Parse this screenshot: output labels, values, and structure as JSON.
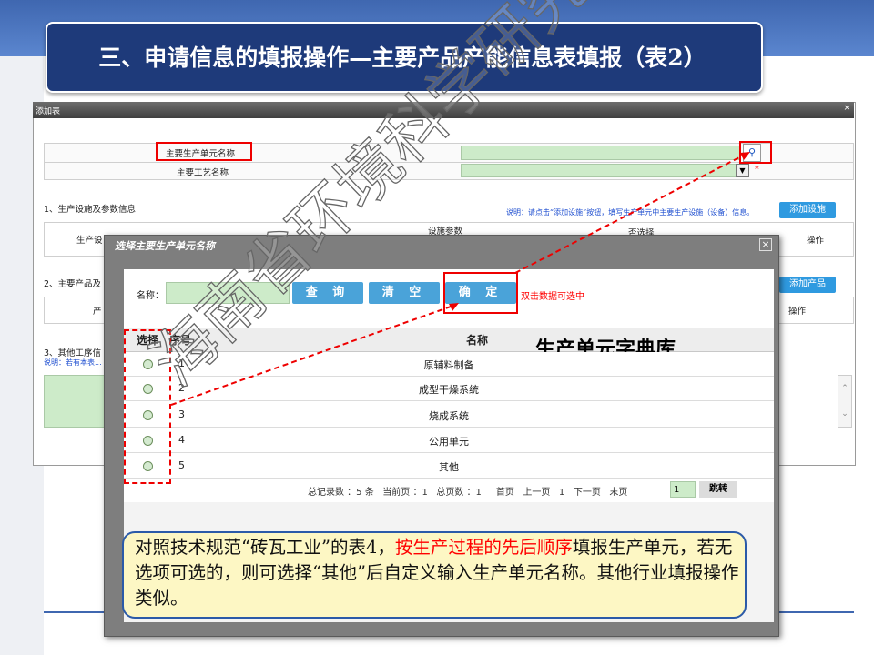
{
  "slide": {
    "title": "三、申请信息的填报操作—主要产品产能信息表填报（表2）"
  },
  "form_window": {
    "title": "添加表",
    "close_glyph": "×",
    "fields": {
      "unit_name_label": "主要生产单元名称",
      "process_name_label": "主要工艺名称",
      "dropdown_arrow": "▼",
      "required_mark": "*"
    },
    "section1": {
      "title": "1、生产设施及参数信息",
      "hint": "说明：请点击“添加设施”按钮，填写生产单元中主要生产设施（设备）信息。",
      "add_button": "添加设施",
      "col_unit": "生产设",
      "col_params": "设施参数",
      "col_other": "否选择",
      "col_ops": "操作"
    },
    "section2": {
      "title": "2、主要产品及",
      "add_button": "添加产品",
      "col_first": "产",
      "col_ops": "操作"
    },
    "section3": {
      "title": "3、其他工序信",
      "hint": "说明：若有本表..."
    }
  },
  "dialog": {
    "title": "选择主要生产单元名称",
    "close_glyph": "×",
    "search_label": "名称：",
    "search_value": "",
    "query_button": "查 询",
    "clear_button": "清 空",
    "confirm_button": "确 定",
    "hint": "双击数据可选中",
    "callout": "生产单元字典库",
    "columns": [
      "选择",
      "序号",
      "名称"
    ],
    "rows": [
      {
        "no": "1",
        "name": "原辅料制备"
      },
      {
        "no": "2",
        "name": "成型干燥系统"
      },
      {
        "no": "3",
        "name": "烧成系统"
      },
      {
        "no": "4",
        "name": "公用单元"
      },
      {
        "no": "5",
        "name": "其他"
      }
    ],
    "pager": {
      "total": "总记录数 ：5 条",
      "current": "当前页 ：1",
      "pages": "总页数 ：1",
      "first": "首页",
      "prev": "上一页",
      "page_num": "1",
      "next": "下一页",
      "last": "末页",
      "goto_value": "1",
      "goto_button": "跳转"
    }
  },
  "note": {
    "part1": "对照技术规范“砖瓦工业”的表4，",
    "part2_red": "按生产过程的先后顺序",
    "part3": "填报生产单元，若无选项可选的，则可选择“其他”后自定义输入生产单元名称。其他行业填报操作类似。"
  },
  "watermark": "海南省环境科学研究院制",
  "colors": {
    "title_bg": "#1e3a7a",
    "top_band": "#3f67b0",
    "accent_red": "#ff0000",
    "note_bg": "#fdf7c4",
    "input_green": "#cdebc9",
    "button_blue": "#4aa3d9"
  }
}
